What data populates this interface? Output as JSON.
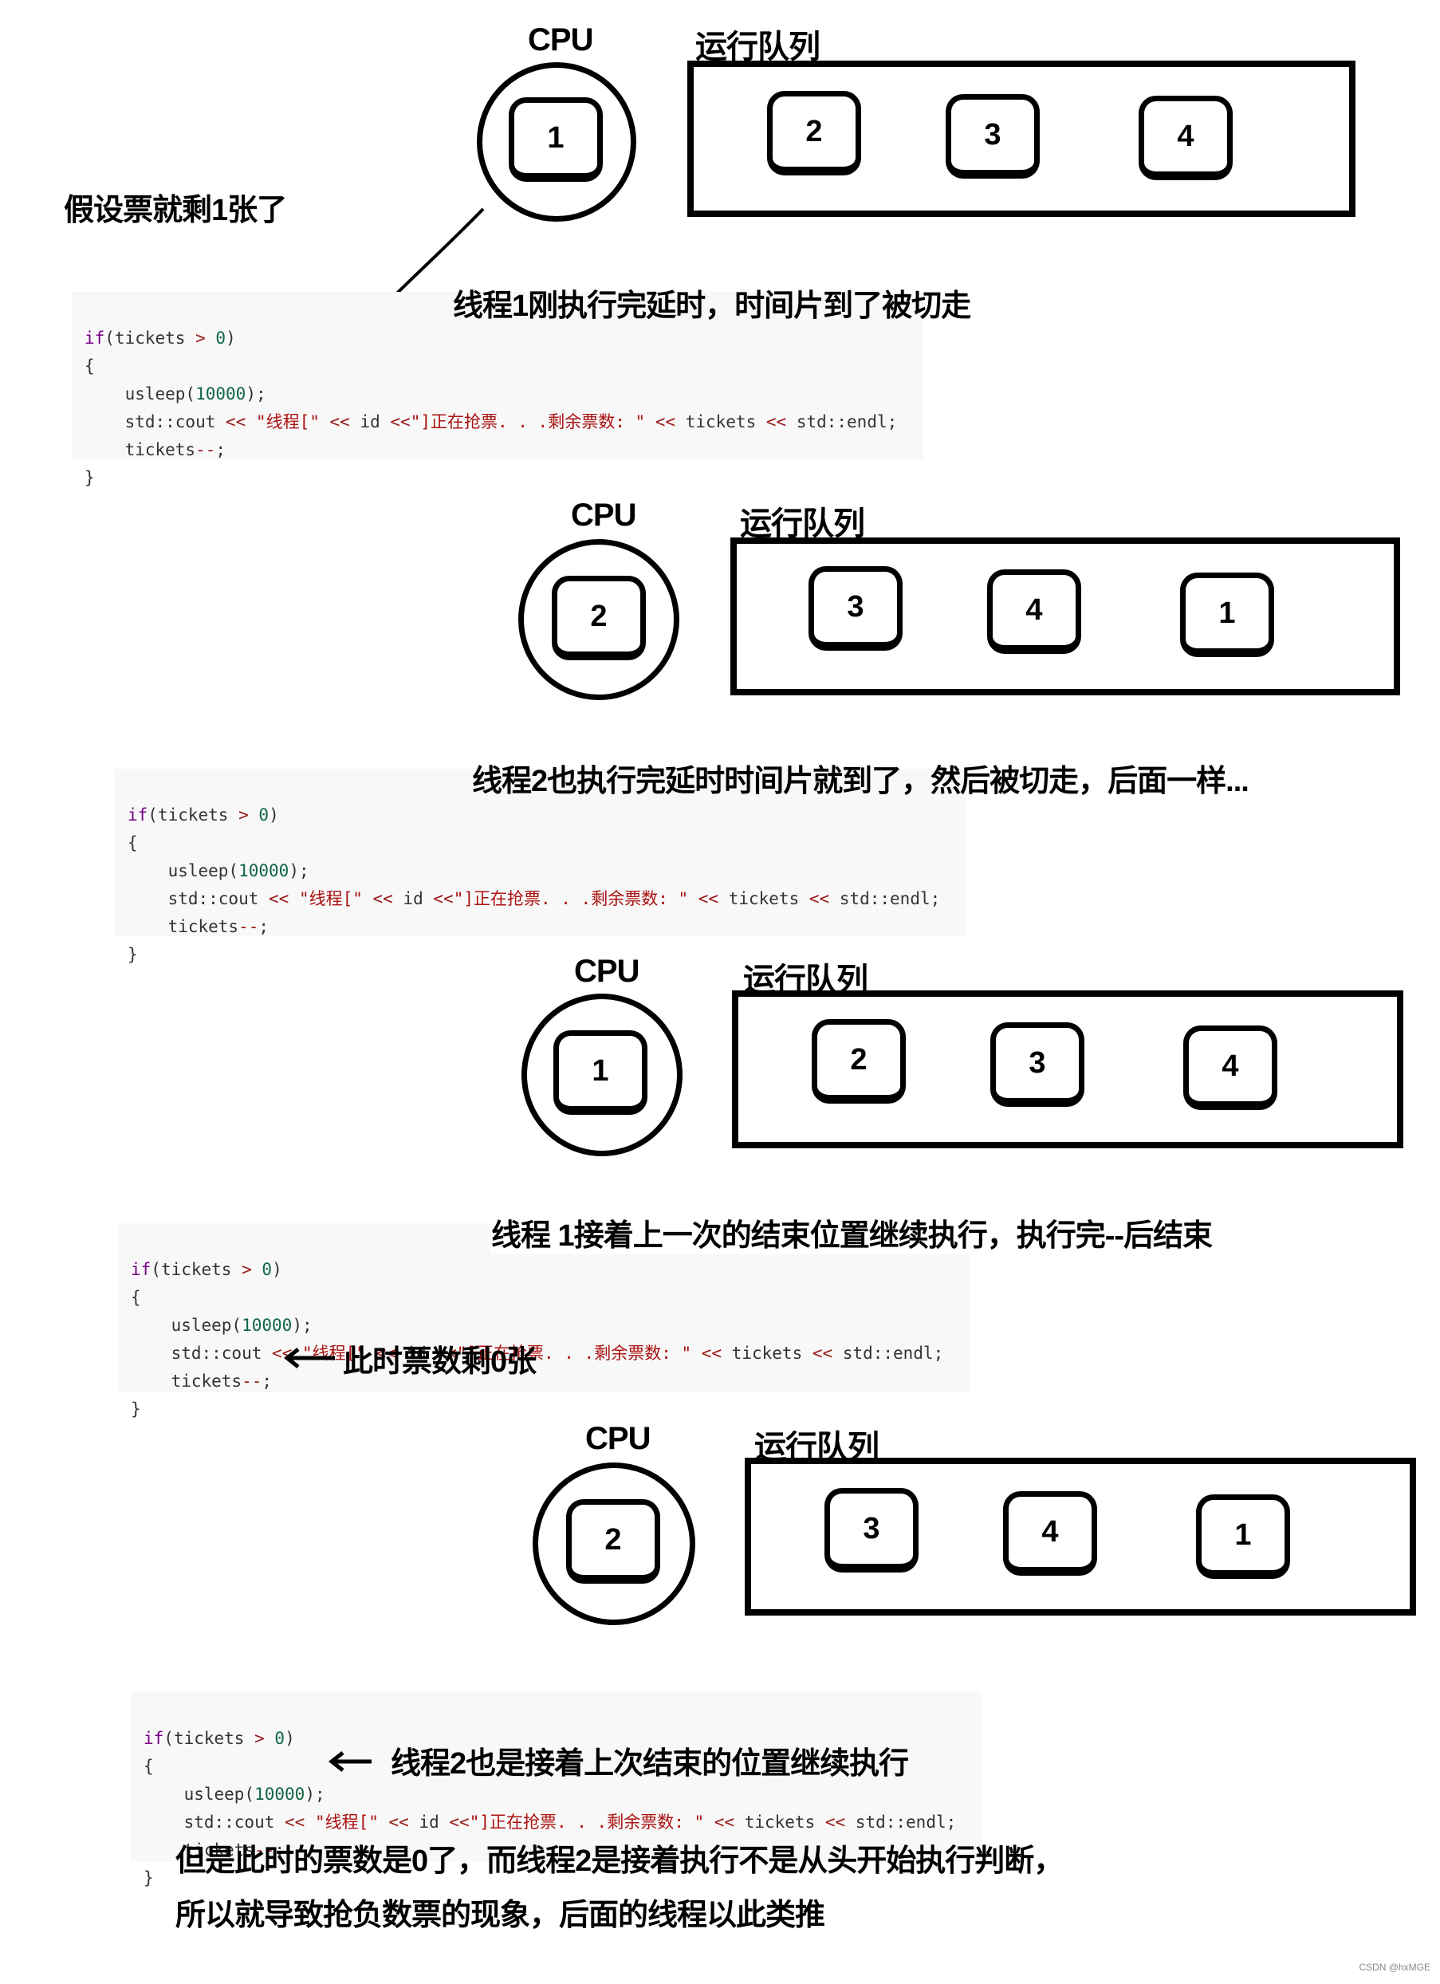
{
  "labels": {
    "cpu": "CPU",
    "queue": "运行队列"
  },
  "code_lines": {
    "if_kw": "if",
    "if_rest_a": "(tickets ",
    "if_op": ">",
    "if_rest_b": " ",
    "if_num": "0",
    "if_close": ")",
    "open_brace": "{",
    "usleep_a": "usleep(",
    "usleep_num": "10000",
    "usleep_b": ");",
    "cout_a": "std::cout ",
    "cout_op1": "<<",
    "cout_str1": " \"线程[\" ",
    "cout_op2": "<<",
    "cout_id": " id ",
    "cout_op3": "<<",
    "cout_str2": "\"]正在抢票. . .剩余票数: \" ",
    "cout_op4": "<<",
    "cout_tickets": " tickets ",
    "cout_op5": "<<",
    "cout_end": " std::endl;",
    "dec_a": "tickets",
    "dec_op": "--",
    "dec_b": ";",
    "close_brace": "}"
  },
  "steps": [
    {
      "cpu_thread": "1",
      "queue": [
        "2",
        "3",
        "4"
      ],
      "caption": "线程1刚执行完延时，时间片到了被切走"
    },
    {
      "cpu_thread": "2",
      "queue": [
        "3",
        "4",
        "1"
      ],
      "caption": "线程2也执行完延时时间片就到了，然后被切走，后面一样..."
    },
    {
      "cpu_thread": "1",
      "queue": [
        "2",
        "3",
        "4"
      ],
      "caption": "线程 1接着上一次的结束位置继续执行，执行完--后结束",
      "inline_note": "此时票数剩0张"
    },
    {
      "cpu_thread": "2",
      "queue": [
        "3",
        "4",
        "1"
      ],
      "inline_note": "线程2也是接着上次结束的位置继续执行"
    }
  ],
  "intro_note": "假设票就剩1张了",
  "conclusion": [
    "但是此时的票数是0了，而线程2是接着执行不是从头开始执行判断，",
    "所以就导致抢负数票的现象，后面的线程以此类推"
  ],
  "watermark": "CSDN @hxMGE"
}
